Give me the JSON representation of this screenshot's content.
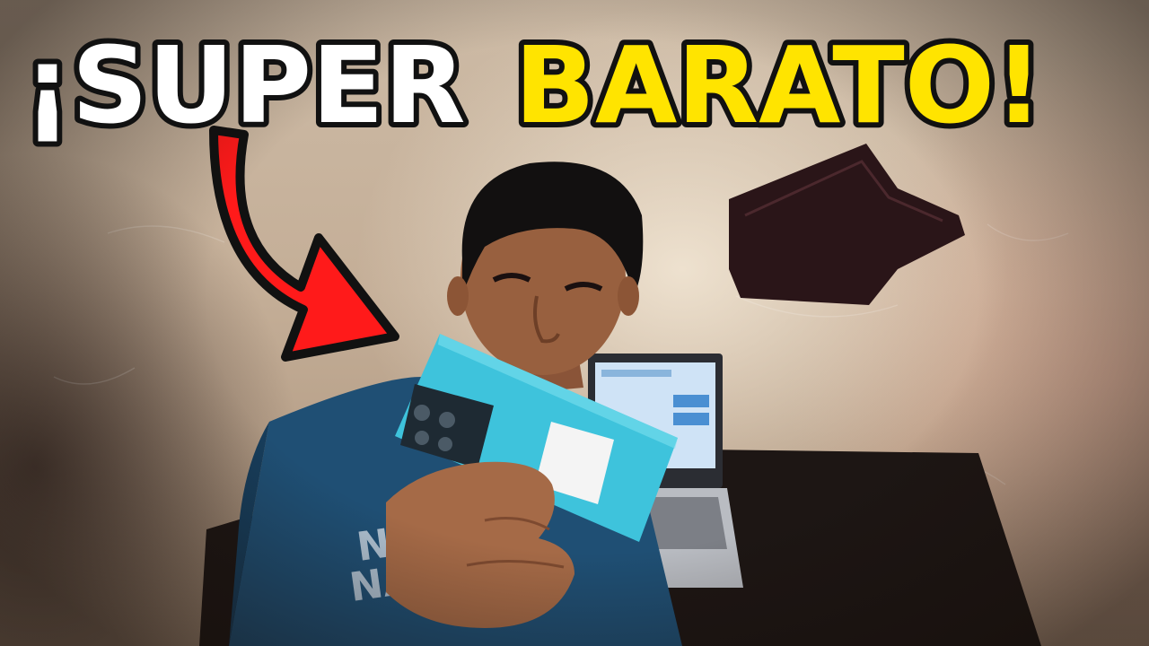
{
  "thumbnail": {
    "headline": {
      "part_white": "¡SUPER",
      "part_yellow": "BARATO!",
      "color_white": "#ffffff",
      "color_yellow": "#ffe400",
      "outline_color": "#111111"
    },
    "arrow": {
      "color": "#ff1a1a",
      "icon": "curved-arrow-down-right"
    },
    "phone": {
      "color": "#3ec3dc"
    },
    "shirt_lettering": "NAVE"
  }
}
